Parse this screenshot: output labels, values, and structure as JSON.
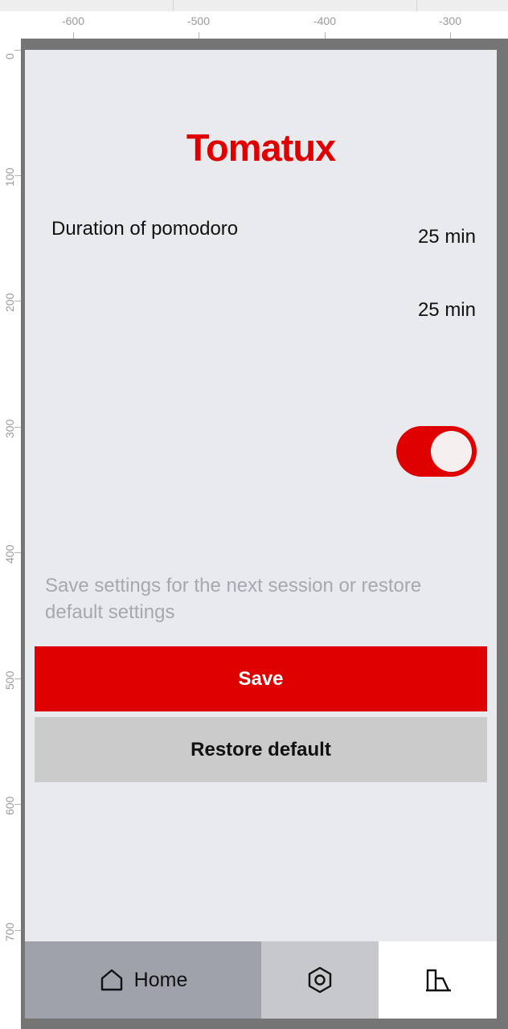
{
  "ruler": {
    "top_labels": [
      "-600",
      "-500",
      "-400",
      "-300"
    ],
    "left_labels": [
      "0",
      "100",
      "200",
      "300",
      "400",
      "500",
      "600",
      "700"
    ]
  },
  "app": {
    "title": "Tomatux",
    "accent_color": "#df0000"
  },
  "settings": {
    "pomodoro_label": "Duration of pomodoro",
    "pomodoro_value": "25 min",
    "second_value": "25 min",
    "toggle_on": true,
    "hint": "Save settings for the next session or restore default settings"
  },
  "actions": {
    "save_label": "Save",
    "restore_label": "Restore default"
  },
  "nav": {
    "home_label": "Home",
    "home_icon": "home-icon",
    "settings_icon": "settings-hex-icon",
    "stats_icon": "bar-chart-icon",
    "active": "home"
  }
}
